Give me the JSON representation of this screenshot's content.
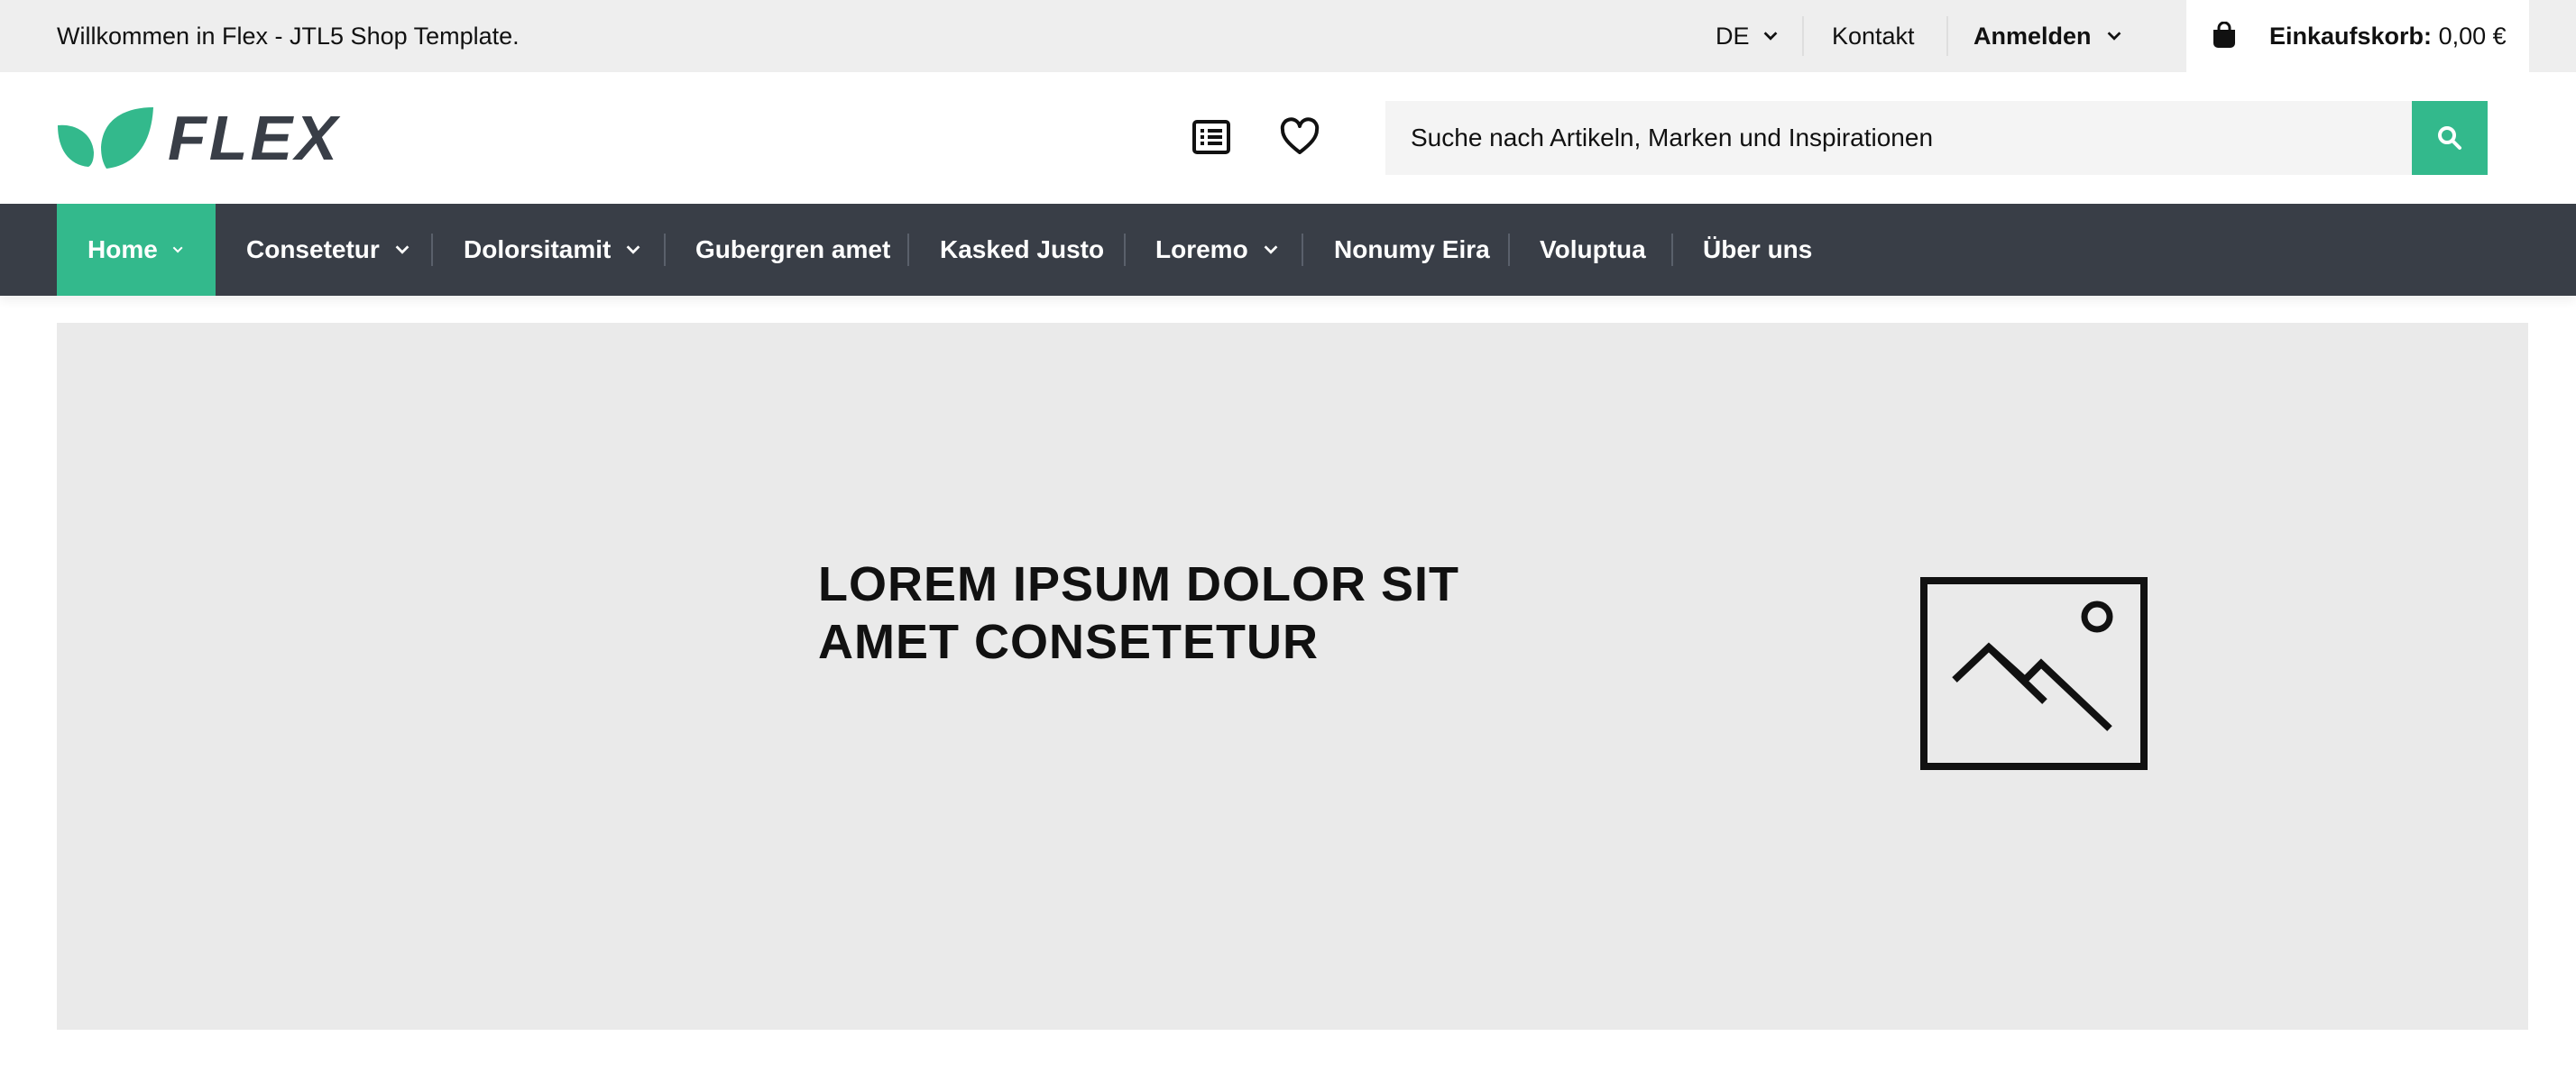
{
  "topbar": {
    "welcome": "Willkommen in Flex - JTL5 Shop Template.",
    "language": "DE",
    "contact": "Kontakt",
    "login": "Anmelden",
    "cart_label": "Einkaufskorb:",
    "cart_value": "0,00 €"
  },
  "header": {
    "brand": "FLEX",
    "search_placeholder": "Suche nach Artikeln, Marken und Inspirationen",
    "icons": [
      "list-icon",
      "heart-icon",
      "search-icon",
      "shopping-bag-icon"
    ]
  },
  "nav": {
    "items": [
      {
        "label": "Home",
        "dropdown": true,
        "active": true
      },
      {
        "label": "Consetetur",
        "dropdown": true
      },
      {
        "label": "Dolorsitamit",
        "dropdown": true
      },
      {
        "label": "Gubergren amet",
        "dropdown": false
      },
      {
        "label": "Kasked Justo",
        "dropdown": false
      },
      {
        "label": "Loremo",
        "dropdown": true
      },
      {
        "label": "Nonumy Eira",
        "dropdown": false
      },
      {
        "label": "Voluptua",
        "dropdown": false
      },
      {
        "label": "Über uns",
        "dropdown": false
      }
    ]
  },
  "banner": {
    "headline_line1": "LOREM IPSUM DOLOR SIT",
    "headline_line2": "AMET CONSETETUR",
    "icon": "image-placeholder-icon"
  },
  "colors": {
    "accent": "#33b98c",
    "nav_bg": "#393e47",
    "topbar_bg": "#eeeeee",
    "banner_bg": "#eaeaea"
  }
}
